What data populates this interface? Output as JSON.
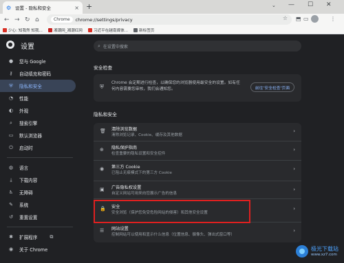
{
  "browser": {
    "tab": {
      "title": "设置 - 隐私和安全",
      "close": "×"
    },
    "new_tab": "+",
    "window": {
      "chevron": "⌄",
      "min": "—",
      "max": "☐",
      "close": "✕"
    },
    "nav": {
      "back": "←",
      "forward": "→",
      "reload": "↻",
      "home": "⌂"
    },
    "omnibox": {
      "chip": "Chrome",
      "url": "chrome://settings/privacy",
      "star": "☆"
    },
    "toolbar_icons": {
      "extensions": "⬒",
      "sidebar": "▭",
      "menu": "⋮"
    },
    "bookmarks": [
      {
        "label": "少心: 知我然 知我...",
        "color": "#d93025"
      },
      {
        "label": "湘潮网_湘潮红网",
        "color": "#c5221f"
      },
      {
        "label": "习近平在越南媒体...",
        "color": "#d93025"
      },
      {
        "label": "新标签页",
        "color": "#5f6368"
      }
    ]
  },
  "settings": {
    "title": "设置",
    "search_placeholder": "在设置中搜索",
    "sidebar": [
      {
        "icon": "google-icon",
        "glyph": "●",
        "label": "您与 Google"
      },
      {
        "icon": "key-icon",
        "glyph": "⚷",
        "label": "自动填充和密码"
      },
      {
        "icon": "shield-icon",
        "glyph": "⛨",
        "label": "隐私和安全",
        "active": true
      },
      {
        "icon": "performance-icon",
        "glyph": "◔",
        "label": "性能"
      },
      {
        "icon": "palette-icon",
        "glyph": "◐",
        "label": "外观"
      },
      {
        "icon": "search-icon",
        "glyph": "⌕",
        "label": "搜索引擎"
      },
      {
        "icon": "browser-icon",
        "glyph": "▭",
        "label": "默认浏览器"
      },
      {
        "icon": "power-icon",
        "glyph": "⏻",
        "label": "启动时"
      },
      {
        "icon": "globe-icon",
        "glyph": "◍",
        "label": "语言"
      },
      {
        "icon": "download-icon",
        "glyph": "⤓",
        "label": "下载内容"
      },
      {
        "icon": "accessibility-icon",
        "glyph": "♿",
        "label": "无障碍"
      },
      {
        "icon": "wrench-icon",
        "glyph": "✎",
        "label": "系统"
      },
      {
        "icon": "reset-icon",
        "glyph": "↺",
        "label": "重置设置"
      },
      {
        "icon": "puzzle-icon",
        "glyph": "✱",
        "label": "扩展程序",
        "external": "⧉"
      },
      {
        "icon": "chrome-icon",
        "glyph": "◉",
        "label": "关于 Chrome"
      }
    ],
    "safety_check": {
      "heading": "安全检查",
      "icon": "shield-check-icon",
      "glyph": "⛨",
      "text": "Chrome 会定期进行检查，以确保您的浏览器使用最安全的设置。如有任何内容需要您审核，我们会通知您。",
      "button": "前往“安全检查”页面"
    },
    "privacy": {
      "heading": "隐私和安全",
      "rows": [
        {
          "icon": "trash-icon",
          "glyph": "🗑",
          "title": "清除浏览数据",
          "desc": "清除浏览记录、Cookie、缓存及其他数据"
        },
        {
          "icon": "privacy-guide-icon",
          "glyph": "⊕",
          "title": "隐私保护指南",
          "desc": "检查重要的隐私设置和安全控件"
        },
        {
          "icon": "cookie-icon",
          "glyph": "◉",
          "title": "第三方 Cookie",
          "desc": "已阻止无痕模式下的第三方 Cookie"
        },
        {
          "icon": "ad-privacy-icon",
          "glyph": "▣",
          "title": "广告隐私权设置",
          "desc": "自定义网站可用来向您展示广告的信息"
        },
        {
          "icon": "lock-icon",
          "glyph": "🔒",
          "title": "安全",
          "desc": "安全浏览（保护您免受危险网站的侵害）和其他安全设置"
        },
        {
          "icon": "sliders-icon",
          "glyph": "☰",
          "title": "网站设置",
          "desc": "控制网站可以使用和显示什么信息（位置信息、摄像头、弹出式窗口等）"
        }
      ],
      "arrow": "›"
    }
  },
  "watermark": {
    "text": "极光下载站",
    "url": "www.xz7.com"
  }
}
